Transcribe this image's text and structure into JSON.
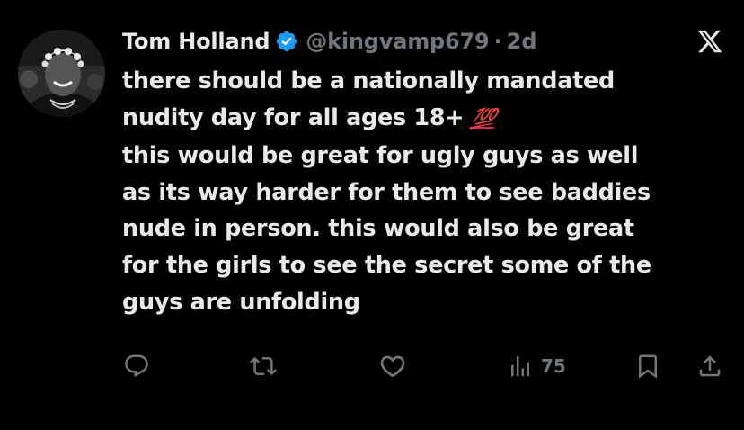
{
  "tweet": {
    "author_name": "Tom Holland",
    "handle": "@kingvamp679",
    "separator": "·",
    "timestamp": "2d",
    "verified_icon": "verified-badge-icon",
    "platform_logo": "x-logo",
    "text_lines": [
      "there should be a nationally mandated",
      "nudity day for all ages 18+",
      "this would be great for ugly guys as well",
      "as its way harder for them to see baddies",
      "nude in person. this would also be great",
      "for the girls to see the secret some of the",
      "guys are unfolding"
    ],
    "emoji": "💯"
  },
  "actions": {
    "reply_icon": "reply-icon",
    "retweet_icon": "retweet-icon",
    "like_icon": "heart-icon",
    "views_icon": "views-icon",
    "views_count": "75",
    "bookmark_icon": "bookmark-icon",
    "share_icon": "share-icon"
  },
  "colors": {
    "background": "#000000",
    "text": "#e7e9ea",
    "muted": "#71767b",
    "verified": "#1d9bf0",
    "emoji_red": "#e0245e"
  }
}
